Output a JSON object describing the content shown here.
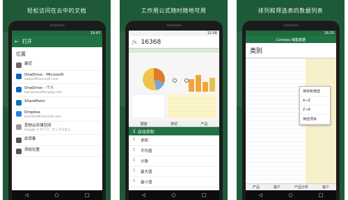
{
  "captions": [
    "轻松访问在云中的文档",
    "工作用公式随时随地可用",
    "排列和筛选表的数据列表"
  ],
  "phone1": {
    "status_time": "19:43",
    "appbar_title": "打开",
    "section": "位置",
    "items": [
      {
        "label": "最近",
        "sub": "",
        "color": "#6b6b6b"
      },
      {
        "label": "OneDrive - Microsoft",
        "sub": "kaitoudfrancisoft.com",
        "color": "#0b63c4"
      },
      {
        "label": "OneDrive - 个人",
        "sub": "kanoichoudherydig.com",
        "color": "#0b63c4"
      },
      {
        "label": "SharePoint",
        "sub": "",
        "color": "#0b72b3"
      },
      {
        "label": "Dropbox",
        "sub": "kaixitoudfrancisoft.com",
        "color": "#2a80e3"
      },
      {
        "label": "其他云存储空间",
        "sub": "Google ドライブ、ボックスなど...",
        "color": "#999999"
      },
      {
        "label": "此设备",
        "sub": "",
        "color": "#555555"
      },
      {
        "label": "添加位置",
        "sub": "",
        "color": "#555555"
      }
    ]
  },
  "phone2": {
    "status_time": "12:08",
    "fx": "fx",
    "formula_value": "16368",
    "tabs": [
      "键盘",
      "按钮",
      "产品"
    ],
    "autosum_label": "自动求和",
    "functions": [
      "求和",
      "平均值",
      "计数",
      "最大值",
      "最小值"
    ]
  },
  "phone3": {
    "status_time": "18:20",
    "sheet_title": "Contoso 销售数据",
    "header_text": "类别",
    "menu": [
      "排序和筛选",
      "A→Z",
      "Z→A",
      "筛选项目"
    ],
    "bottom_tabs": [
      "产品",
      "客户",
      "产品分析",
      "客户"
    ]
  },
  "colors": {
    "excel_green": "#217346",
    "banner_green": "#1f5a38"
  }
}
